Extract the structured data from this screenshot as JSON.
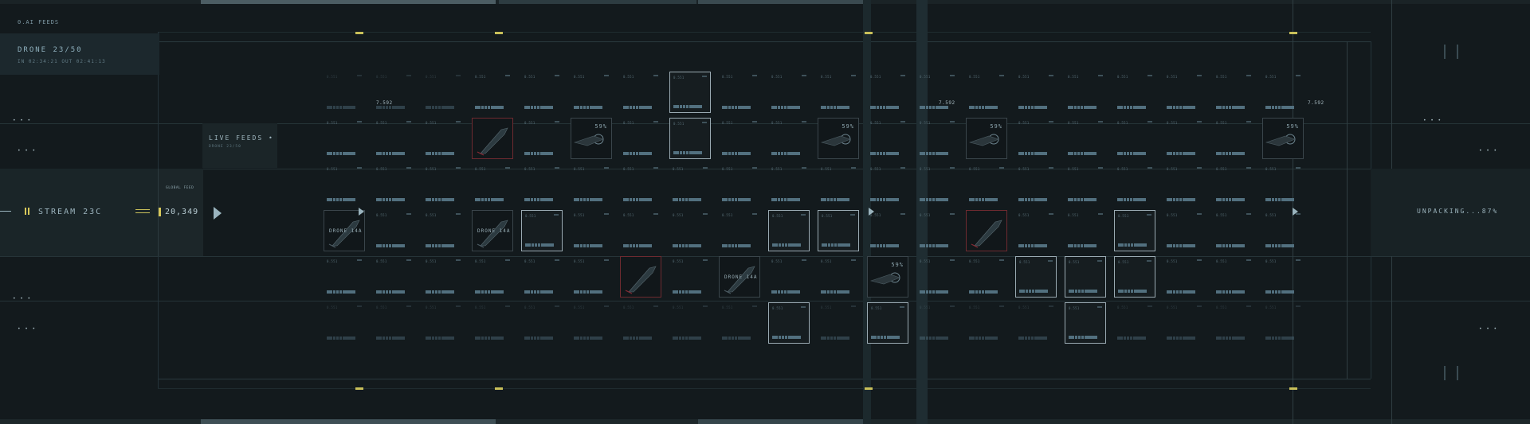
{
  "left_panel": {
    "title": "0.AI FEEDS",
    "drone_label": "DRONE 23/50",
    "in_out": "IN 02:34:21  OUT 02:41:13",
    "stream_label": "STREAM 23C",
    "accent_yellow": "#d6c75a"
  },
  "global_feed": {
    "label": "GLOBAL FEED",
    "count": "20,349"
  },
  "live_feeds": {
    "title": "LIVE FEEDS •",
    "sub": "DRONE 23/50"
  },
  "grid": {
    "cell_code": "0.551",
    "value_label": "7.592",
    "drone_label": "DRONE 14A",
    "percent_label": "59%"
  },
  "status": {
    "unpacking": "UNPACKING...87%"
  },
  "icons": {
    "play": "play-triangle-icon",
    "ellipsis": "dots-icon"
  },
  "colors": {
    "background": "#131a1d",
    "panel": "#1c282d",
    "highlight_border": "#9aaab2",
    "red_accent": "#6e2a30"
  }
}
